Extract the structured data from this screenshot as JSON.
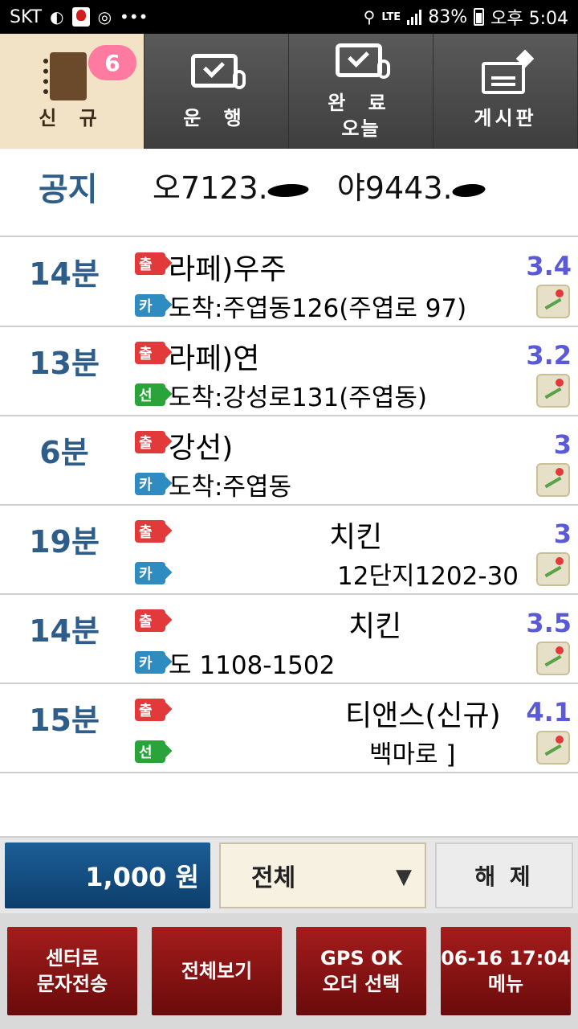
{
  "status_bar": {
    "carrier": "SKT",
    "network": "LTE",
    "battery": "83%",
    "time": "오후 5:04"
  },
  "tabs": [
    {
      "label": "신 규",
      "badge": "6",
      "icon": "notebook-icon",
      "active": true
    },
    {
      "label": "운 행",
      "icon": "monitor-check-icon",
      "active": false
    },
    {
      "label": "완 료\n오늘",
      "line1": "완 료",
      "line2": "오늘",
      "icon": "monitor-check-icon",
      "active": false
    },
    {
      "label": "게시판",
      "icon": "bulletin-board-icon",
      "active": false
    }
  ],
  "notice": {
    "title": "공지",
    "text_part1": "오7123.",
    "text_part2": "야9443."
  },
  "orders": [
    {
      "time": "14분",
      "start_tag": "출",
      "pay_tag": "카",
      "pay_type": "card",
      "from": "라페)우주",
      "to": "도착:주엽동126(주엽로 97)",
      "distance": "3.4"
    },
    {
      "time": "13분",
      "start_tag": "출",
      "pay_tag": "선",
      "pay_type": "prepaid",
      "from": "라페)연",
      "to": "도착:강성로131(주엽동)",
      "distance": "3.2"
    },
    {
      "time": "6분",
      "start_tag": "출",
      "pay_tag": "카",
      "pay_type": "card",
      "from": "강선)",
      "to": "도착:주엽동",
      "distance": "3"
    },
    {
      "time": "19분",
      "start_tag": "출",
      "pay_tag": "카",
      "pay_type": "card",
      "from": "치킨",
      "to": "12단지1202-30",
      "distance": "3"
    },
    {
      "time": "14분",
      "start_tag": "출",
      "pay_tag": "카",
      "pay_type": "card",
      "from": "치킨",
      "to": "도 1108-1502",
      "distance": "3.5"
    },
    {
      "time": "15분",
      "start_tag": "출",
      "pay_tag": "선",
      "pay_type": "prepaid",
      "from": "티앤스(신규)",
      "to": "백마로 ]",
      "distance": "4.1"
    }
  ],
  "bottom_bar": {
    "amount": "1,000 원",
    "filter_value": "전체",
    "clear_label": "해 제"
  },
  "actions": [
    {
      "line1": "센터로",
      "line2": "문자전송"
    },
    {
      "line1": "전체보기",
      "line2": ""
    },
    {
      "line1": "GPS OK",
      "line2": "오더 선택"
    },
    {
      "line1": "06-16 17:04",
      "line2": "메뉴"
    }
  ],
  "colors": {
    "active_tab_bg": "#f2e3c6",
    "tab_bg": "#4e4e4e",
    "time_text": "#2f5d8a",
    "distance_text": "#5a5ad8",
    "action_button": "#8a1414",
    "amount_box": "#0c3e6b",
    "start_tag": "#e23a3a",
    "card_tag": "#2e8cc0",
    "prepaid_tag": "#2aa33b",
    "badge": "#ff7aa0"
  }
}
